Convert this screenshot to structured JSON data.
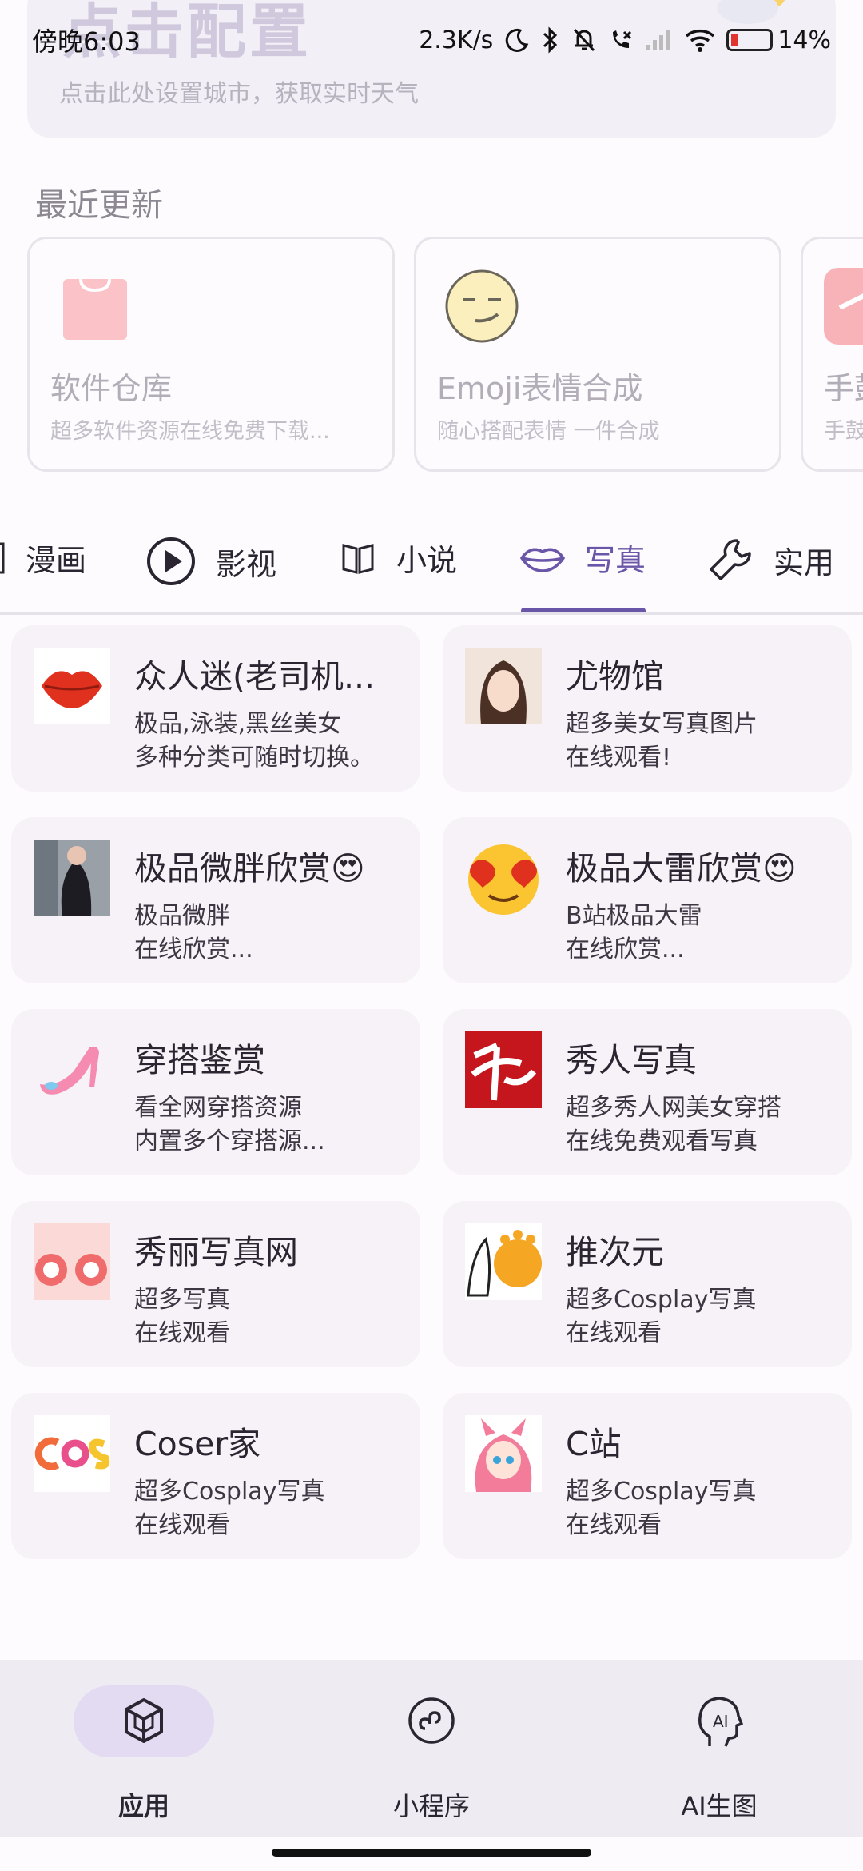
{
  "status": {
    "time": "傍晚6:03",
    "net_speed": "2.3K/s",
    "battery": "14%"
  },
  "weather": {
    "title": "点击配置",
    "subtitle": "点击此处设置城市，获取实时天气"
  },
  "recent": {
    "title": "最近更新",
    "items": [
      {
        "title": "软件仓库",
        "sub": "超多软件资源在线免费下载..."
      },
      {
        "title": "Emoji表情合成",
        "sub": "随心搭配表情 一件合成"
      },
      {
        "title": "手鼓",
        "sub": "手鼓"
      }
    ]
  },
  "tabs": [
    {
      "label": "漫画",
      "icon": "book-icon"
    },
    {
      "label": "影视",
      "icon": "play-icon"
    },
    {
      "label": "小说",
      "icon": "open-book-icon"
    },
    {
      "label": "写真",
      "icon": "lips-icon",
      "active": true
    },
    {
      "label": "实用",
      "icon": "wrench-icon"
    }
  ],
  "apps": [
    {
      "title": "众人迷(老司机...",
      "line1": "极品,泳装,黑丝美女",
      "line2": "多种分类可随时切换。"
    },
    {
      "title": "尤物馆",
      "line1": "超多美女写真图片",
      "line2": "在线观看!"
    },
    {
      "title": "极品微胖欣赏😍",
      "line1": "极品微胖",
      "line2": "在线欣赏..."
    },
    {
      "title": "极品大雷欣赏😍",
      "line1": "B站极品大雷",
      "line2": "在线欣赏..."
    },
    {
      "title": "穿搭鉴赏",
      "line1": "看全网穿搭资源",
      "line2": "内置多个穿搭源..."
    },
    {
      "title": "秀人写真",
      "line1": "超多秀人网美女穿搭",
      "line2": "在线免费观看写真"
    },
    {
      "title": "秀丽写真网",
      "line1": "超多写真",
      "line2": "在线观看"
    },
    {
      "title": "推次元",
      "line1": "超多Cosplay写真",
      "line2": "在线观看"
    },
    {
      "title": "Coser家",
      "line1": "超多Cosplay写真",
      "line2": "在线观看"
    },
    {
      "title": "C站",
      "line1": "超多Cosplay写真",
      "line2": "在线观看"
    }
  ],
  "nav": [
    {
      "label": "应用",
      "active": true
    },
    {
      "label": "小程序"
    },
    {
      "label": "AI生图"
    }
  ],
  "colors": {
    "accent": "#6a56a8",
    "card_bg": "#f6f2f8",
    "nav_bg": "#efebf3"
  }
}
